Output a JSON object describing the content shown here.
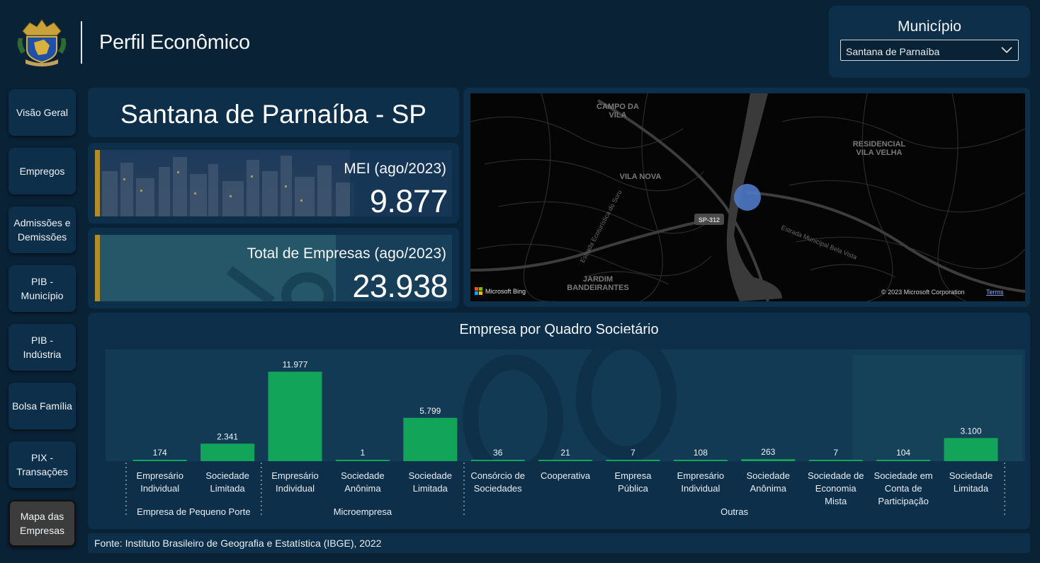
{
  "header": {
    "title": "Perfil Econômico"
  },
  "filter": {
    "label": "Município",
    "selected": "Santana de Parnaíba"
  },
  "nav": [
    {
      "id": "visao-geral",
      "label": "Visão Geral"
    },
    {
      "id": "empregos",
      "label": "Empregos"
    },
    {
      "id": "admissoes-demissoes",
      "label": "Admissões e Demissões"
    },
    {
      "id": "pib-municipio",
      "label": "PIB - Município"
    },
    {
      "id": "pib-industria",
      "label": "PIB - Indústria"
    },
    {
      "id": "bolsa-familia",
      "label": "Bolsa Família"
    },
    {
      "id": "pix-transacoes",
      "label": "PIX - Transações"
    },
    {
      "id": "mapa-empresas",
      "label": "Mapa das Empresas",
      "active": true
    }
  ],
  "city": {
    "title": "Santana de Parnaíba - SP"
  },
  "kpis": {
    "mei": {
      "label": "MEI (ago/2023)",
      "value": "9.877"
    },
    "total": {
      "label": "Total de Empresas (ago/2023)",
      "value": "23.938"
    }
  },
  "map": {
    "places": [
      "CAMPO DA VILA",
      "RESIDENCIAL VILA VELHA",
      "VILA NOVA",
      "JARDIM BANDEIRANTES"
    ],
    "road_shield": "SP-312",
    "road_labels": [
      "Estrada Ecoturística do Suru",
      "Estrada Municipal Bela Vista"
    ],
    "brand": "Microsoft Bing",
    "copyright": "© 2023 Microsoft Corporation",
    "terms": "Terms",
    "marker_color": "#4f79c6"
  },
  "chart_data": {
    "type": "bar",
    "title": "Empresa por Quadro Societário",
    "bar_color": "#12a55a",
    "ylim": [
      0,
      12500
    ],
    "groups": [
      {
        "name": "Empresa de Pequeno Porte",
        "categories": [
          "Empresário Individual",
          "Sociedade Limitada"
        ],
        "values": [
          174,
          2341
        ],
        "labels": [
          "174",
          "2.341"
        ]
      },
      {
        "name": "Microempresa",
        "categories": [
          "Empresário Individual",
          "Sociedade Anônima",
          "Sociedade Limitada"
        ],
        "values": [
          11977,
          1,
          5799
        ],
        "labels": [
          "11.977",
          "1",
          "5.799"
        ]
      },
      {
        "name": "Outras",
        "categories": [
          "Consórcio de Sociedades",
          "Cooperativa",
          "Empresa Pública",
          "Empresário Individual",
          "Sociedade Anônima",
          "Sociedade de Economia Mista",
          "Sociedade em Conta de Participação",
          "Sociedade Limitada"
        ],
        "values": [
          36,
          21,
          7,
          108,
          263,
          7,
          104,
          3100
        ],
        "labels": [
          "36",
          "21",
          "7",
          "108",
          "263",
          "7",
          "104",
          "3.100"
        ]
      }
    ]
  },
  "source": {
    "text": "Fonte: Instituto Brasileiro de Geografia e Estatística (IBGE), 2022"
  },
  "colors": {
    "background": "#0a2236",
    "panel": "#0e2f4a",
    "accent_gold": "#b08d2a",
    "bar_green": "#12a55a"
  }
}
